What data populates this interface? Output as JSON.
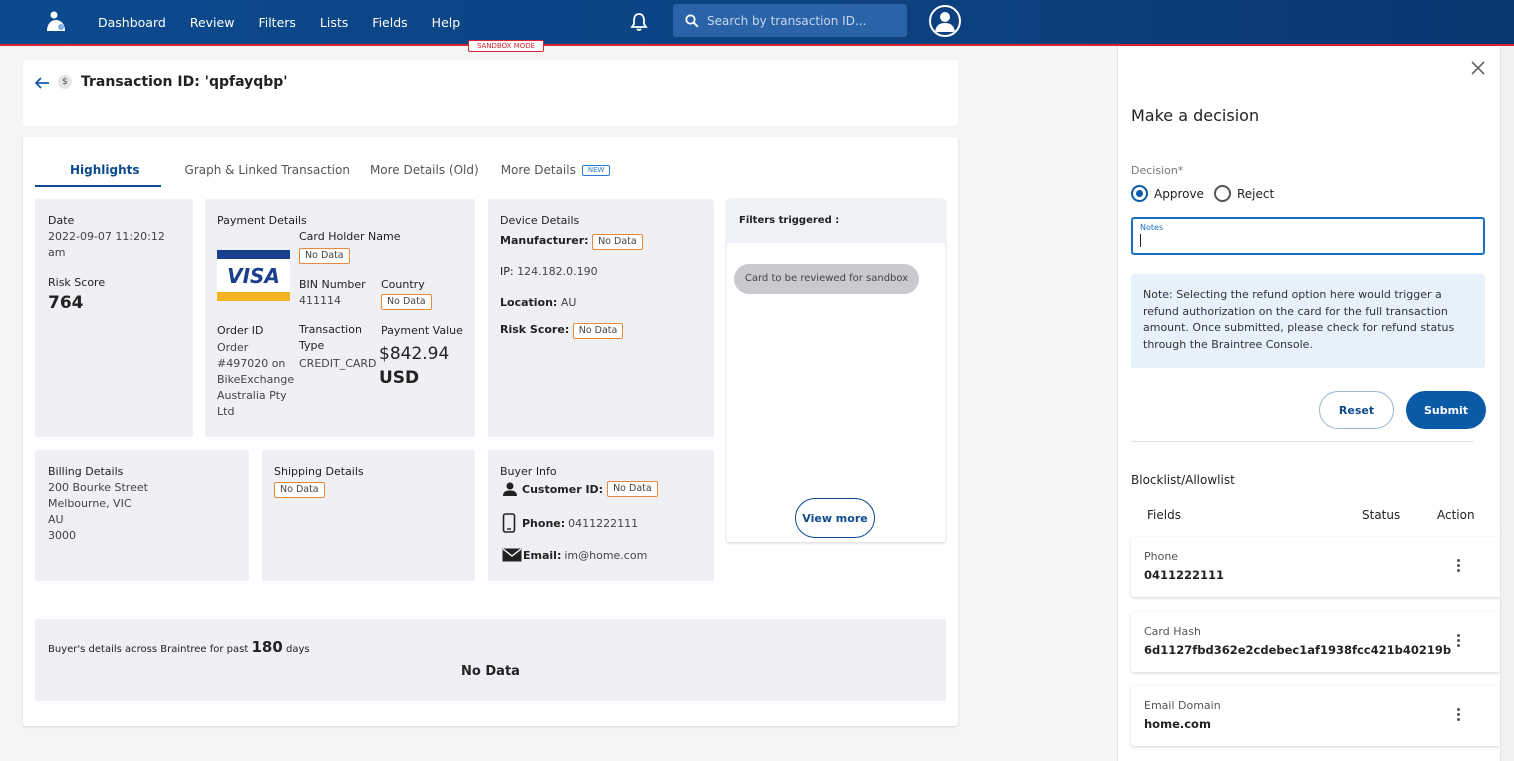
{
  "nav": {
    "items": [
      "Dashboard",
      "Review",
      "Filters",
      "Lists",
      "Fields",
      "Help"
    ],
    "search_placeholder": "Search by transaction ID...",
    "sandbox_label": "SANDBOX MODE"
  },
  "header": {
    "title": "Transaction ID: 'qpfayqbp'",
    "currency_symbol": "$"
  },
  "tabs": [
    {
      "label": "Highlights",
      "active": true
    },
    {
      "label": "Graph & Linked Transaction",
      "active": false
    },
    {
      "label": "More Details (Old)",
      "active": false
    },
    {
      "label": "More Details",
      "badge": "NEW",
      "active": false
    }
  ],
  "summary": {
    "date_label": "Date",
    "date_value": "2022-09-07 11:20:12 am",
    "risk_label": "Risk Score",
    "risk_value": "764"
  },
  "payment": {
    "title": "Payment Details",
    "card_brand": "VISA",
    "holder_label": "Card Holder Name",
    "holder_value": "No Data",
    "bin_label": "BIN Number",
    "bin_value": "411114",
    "country_label": "Country",
    "country_value": "No Data",
    "order_label": "Order ID",
    "order_value": "Order #497020 on BikeExchange Australia Pty Ltd",
    "type_label": "Transaction Type",
    "type_value": "CREDIT_CARD",
    "amount_label": "Payment Value",
    "amount_value": "$842.94",
    "currency": "USD"
  },
  "device": {
    "title": "Device Details",
    "manufacturer_label": "Manufacturer:",
    "manufacturer_value": "No Data",
    "ip_label": "IP:",
    "ip_value": "124.182.0.190",
    "location_label": "Location:",
    "location_value": "AU",
    "risk_label": "Risk Score:",
    "risk_value": "No Data"
  },
  "filters": {
    "title": "Filters triggered :",
    "chip": "Card to be reviewed for sandbox",
    "view_more": "View more"
  },
  "billing": {
    "title": "Billing Details",
    "line1": "200 Bourke Street",
    "line2": "Melbourne, VIC",
    "line3": "AU",
    "line4": "3000"
  },
  "shipping": {
    "title": "Shipping Details",
    "value": "No Data"
  },
  "buyer": {
    "title": "Buyer Info",
    "customer_label": "Customer ID:",
    "customer_value": "No Data",
    "phone_label": "Phone:",
    "phone_value": "0411222111",
    "email_label": "Email:",
    "email_value": "im@home.com"
  },
  "across": {
    "prefix": "Buyer's details across Braintree for past",
    "days": "180",
    "suffix": "days",
    "empty": "No Data"
  },
  "decision": {
    "title": "Make a decision",
    "label": "Decision*",
    "approve": "Approve",
    "reject": "Reject",
    "selected": "Approve",
    "notes_label": "Notes",
    "notes_value": "",
    "note_text": "Note: Selecting the refund option here would trigger a refund authorization on the card for the full transaction amount. Once submitted, please check for refund status through the Braintree Console.",
    "reset": "Reset",
    "submit": "Submit"
  },
  "blocklist": {
    "title": "Blocklist/Allowlist",
    "col_fields": "Fields",
    "col_status": "Status",
    "col_action": "Action",
    "rows": [
      {
        "key": "Phone",
        "value": "0411222111"
      },
      {
        "key": "Card Hash",
        "value": "6d1127fbd362e2cdebec1af1938fcc421b40219b"
      },
      {
        "key": "Email Domain",
        "value": "home.com"
      }
    ]
  },
  "colors": {
    "brand": "#0b4a8e",
    "accent_red": "#d9232e",
    "nodata_border": "#e8883a"
  }
}
